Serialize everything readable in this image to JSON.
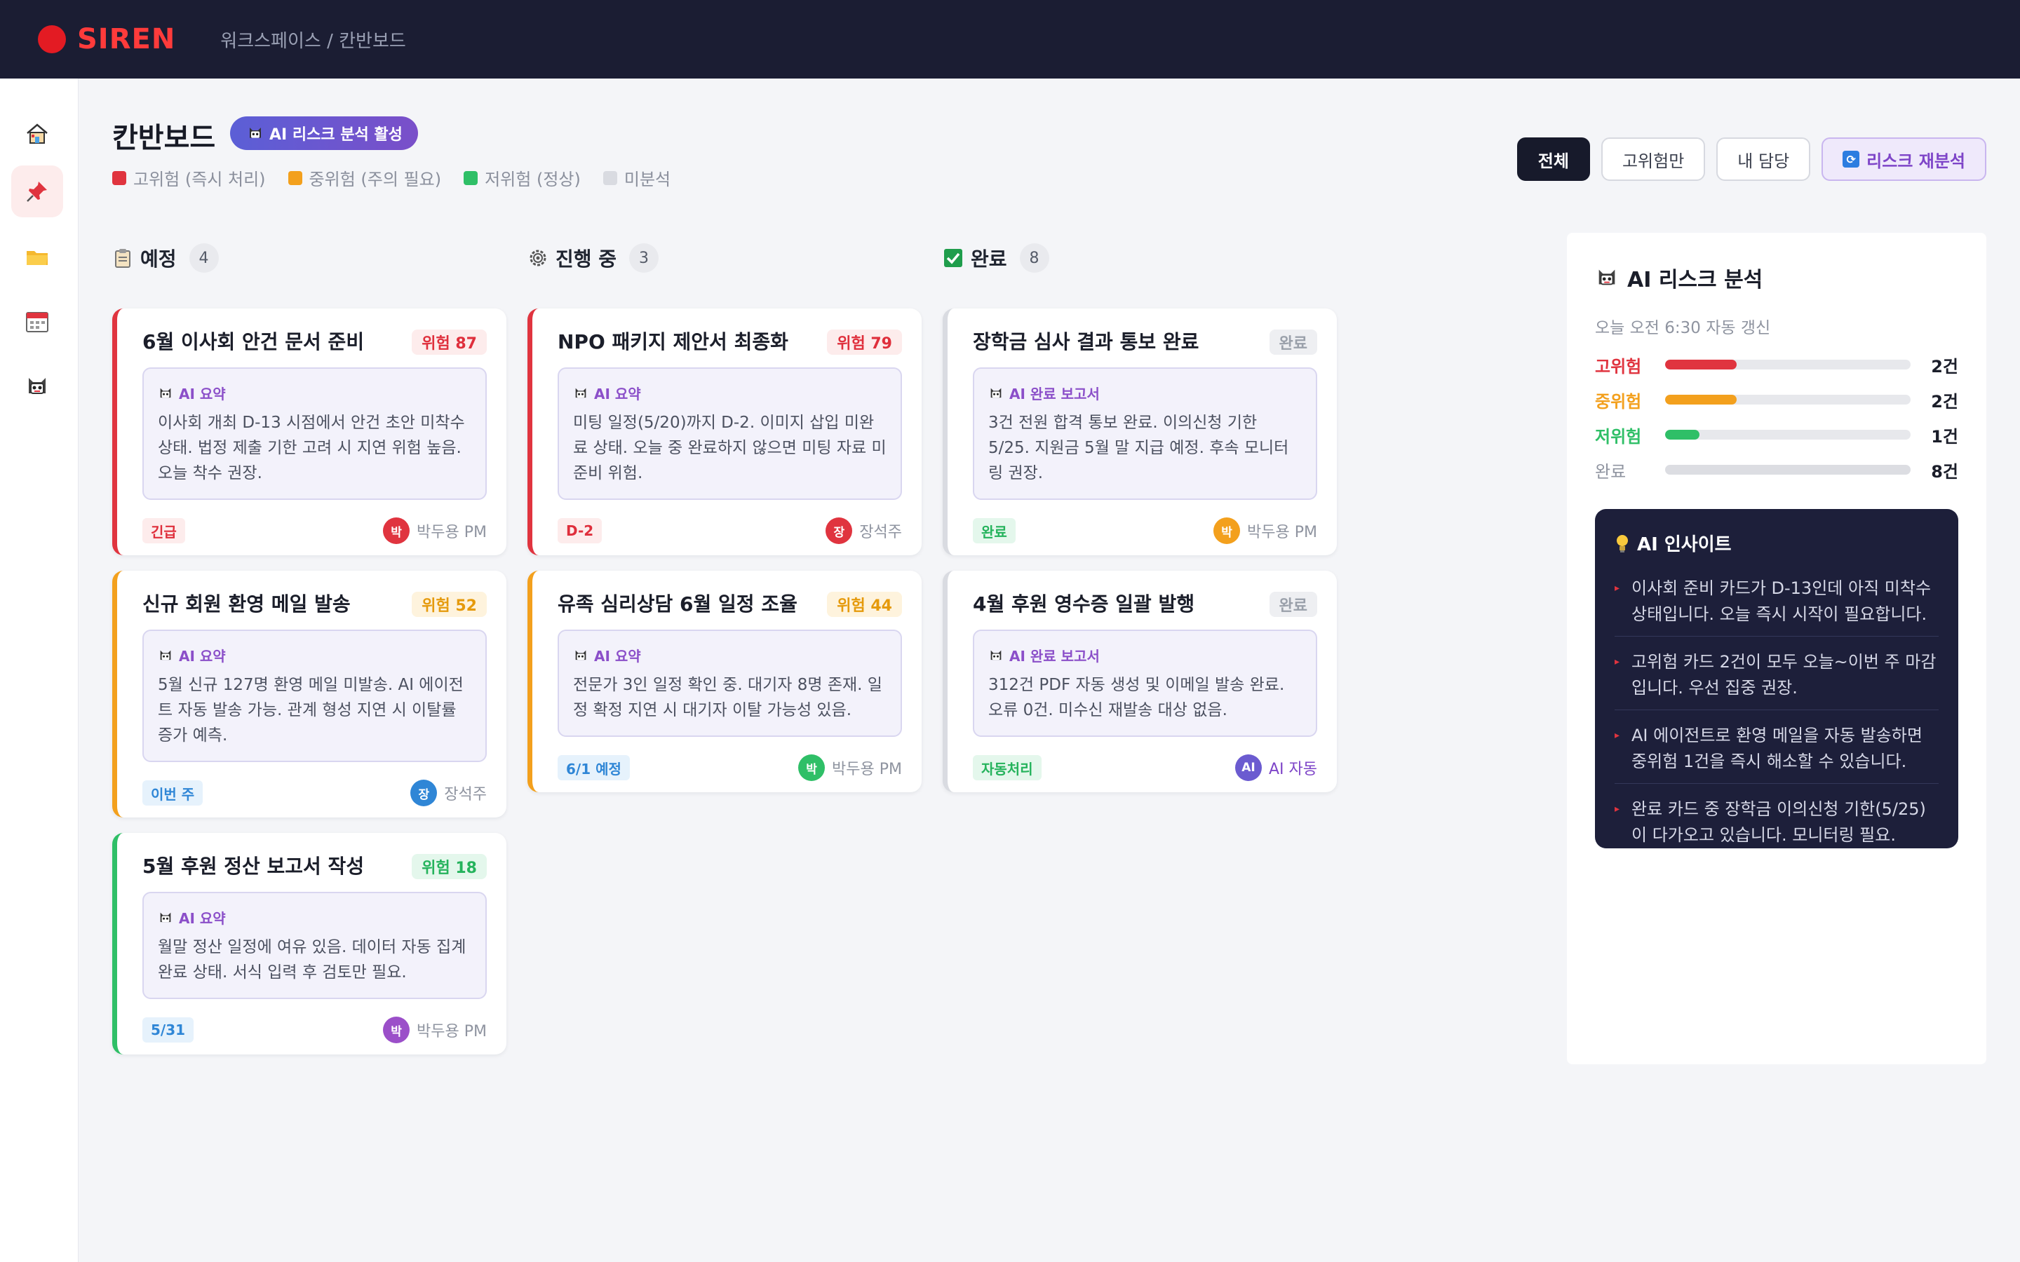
{
  "header": {
    "logo": "SIREN",
    "breadcrumb": "워크스페이스 / 칸반보드"
  },
  "sidebar": {
    "items": [
      {
        "name": "home",
        "icon": "home-icon"
      },
      {
        "name": "pin",
        "icon": "pushpin-icon",
        "active": true
      },
      {
        "name": "folder",
        "icon": "folder-icon"
      },
      {
        "name": "calendar",
        "icon": "calendar-icon"
      },
      {
        "name": "ai",
        "icon": "robot-icon"
      }
    ]
  },
  "page": {
    "title": "칸반보드",
    "ai_badge": "AI 리스크 분석 활성",
    "legend": [
      {
        "label": "고위험 (즉시 처리)",
        "color": "#e0343f"
      },
      {
        "label": "중위험 (주의 필요)",
        "color": "#f3a01d"
      },
      {
        "label": "저위험 (정상)",
        "color": "#2fbf67"
      },
      {
        "label": "미분석",
        "color": "#d9dbe1"
      }
    ]
  },
  "filters": {
    "all": "전체",
    "high_only": "고위험만",
    "mine": "내 담당",
    "reanalyze": "리스크 재분석"
  },
  "columns": [
    {
      "title": "예정",
      "count": "4",
      "cards": [
        {
          "title": "6월 이사회 안건 문서 준비",
          "risk": "위험 87",
          "level": "high",
          "summary_label": "AI 요약",
          "summary": "이사회 개최 D-13 시점에서 안건 초안 미착수 상태. 법정 제출 기한 고려 시 지연 위험 높음. 오늘 착수 권장.",
          "tag": "긴급",
          "tag_color": "red",
          "avatar": "박",
          "avatar_color": "#e0343f",
          "assignee": "박두용 PM"
        },
        {
          "title": "신규 회원 환영 메일 발송",
          "risk": "위험 52",
          "level": "mid",
          "summary_label": "AI 요약",
          "summary": "5월 신규 127명 환영 메일 미발송. AI 에이전트 자동 발송 가능. 관계 형성 지연 시 이탈률 증가 예측.",
          "tag": "이번 주",
          "tag_color": "blue",
          "avatar": "장",
          "avatar_color": "#2f86d6",
          "assignee": "장석주"
        },
        {
          "title": "5월 후원 정산 보고서 작성",
          "risk": "위험 18",
          "level": "low",
          "summary_label": "AI 요약",
          "summary": "월말 정산 일정에 여유 있음. 데이터 자동 집계 완료 상태. 서식 입력 후 검토만 필요.",
          "tag": "5/31",
          "tag_color": "blue",
          "avatar": "박",
          "avatar_color": "#9b4fc9",
          "assignee": "박두용 PM"
        }
      ]
    },
    {
      "title": "진행 중",
      "count": "3",
      "cards": [
        {
          "title": "NPO 패키지 제안서 최종화",
          "risk": "위험 79",
          "level": "high",
          "summary_label": "AI 요약",
          "summary": "미팅 일정(5/20)까지 D-2. 이미지 삽입 미완료 상태. 오늘 중 완료하지 않으면 미팅 자료 미준비 위험.",
          "tag": "D-2",
          "tag_color": "red",
          "avatar": "장",
          "avatar_color": "#e0343f",
          "assignee": "장석주"
        },
        {
          "title": "유족 심리상담 6월 일정 조율",
          "risk": "위험 44",
          "level": "mid",
          "summary_label": "AI 요약",
          "summary": "전문가 3인 일정 확인 중. 대기자 8명 존재. 일정 확정 지연 시 대기자 이탈 가능성 있음.",
          "tag": "6/1 예정",
          "tag_color": "blue",
          "avatar": "박",
          "avatar_color": "#2fbf67",
          "assignee": "박두용 PM"
        }
      ]
    },
    {
      "title": "완료",
      "count": "8",
      "cards": [
        {
          "title": "장학금 심사 결과 통보 완료",
          "risk": "완료",
          "level": "done",
          "summary_label": "AI 완료 보고서",
          "summary": "3건 전원 합격 통보 완료. 이의신청 기한 5/25. 지원금 5월 말 지급 예정. 후속 모니터링 권장.",
          "tag": "완료",
          "tag_color": "green",
          "avatar": "박",
          "avatar_color": "#f3a01d",
          "assignee": "박두용 PM"
        },
        {
          "title": "4월 후원 영수증 일괄 발행",
          "risk": "완료",
          "level": "done",
          "summary_label": "AI 완료 보고서",
          "summary": "312건 PDF 자동 생성 및 이메일 발송 완료. 오류 0건. 미수신 재발송 대상 없음.",
          "tag": "자동처리",
          "tag_color": "green",
          "avatar": "AI",
          "avatar_color": "#6b5bd0",
          "assignee": "AI 자동"
        }
      ]
    }
  ],
  "panel": {
    "title": "AI 리스크 분석",
    "updated": "오늘 오전 6:30 자동 갱신",
    "stats": [
      {
        "label": "고위험",
        "value": "2건",
        "fraction": 0.29,
        "color": "#e0343f"
      },
      {
        "label": "중위험",
        "value": "2건",
        "fraction": 0.29,
        "color": "#f3a01d"
      },
      {
        "label": "저위험",
        "value": "1건",
        "fraction": 0.14,
        "color": "#2fbf67"
      },
      {
        "label": "완료",
        "value": "8건",
        "fraction": 1.0,
        "color": "#dcdde2"
      }
    ],
    "insight_title": "AI 인사이트",
    "insights": [
      "이사회 준비 카드가 D-13인데 아직 미착수 상태입니다. 오늘 즉시 시작이 필요합니다.",
      "고위험 카드 2건이 모두 오늘~이번 주 마감입니다. 우선 집중 권장.",
      "AI 에이전트로 환영 메일을 자동 발송하면 중위험 1건을 즉시 해소할 수 있습니다.",
      "완료 카드 중 장학금 이의신청 기한(5/25)이 다가오고 있습니다. 모니터링 필요."
    ]
  }
}
